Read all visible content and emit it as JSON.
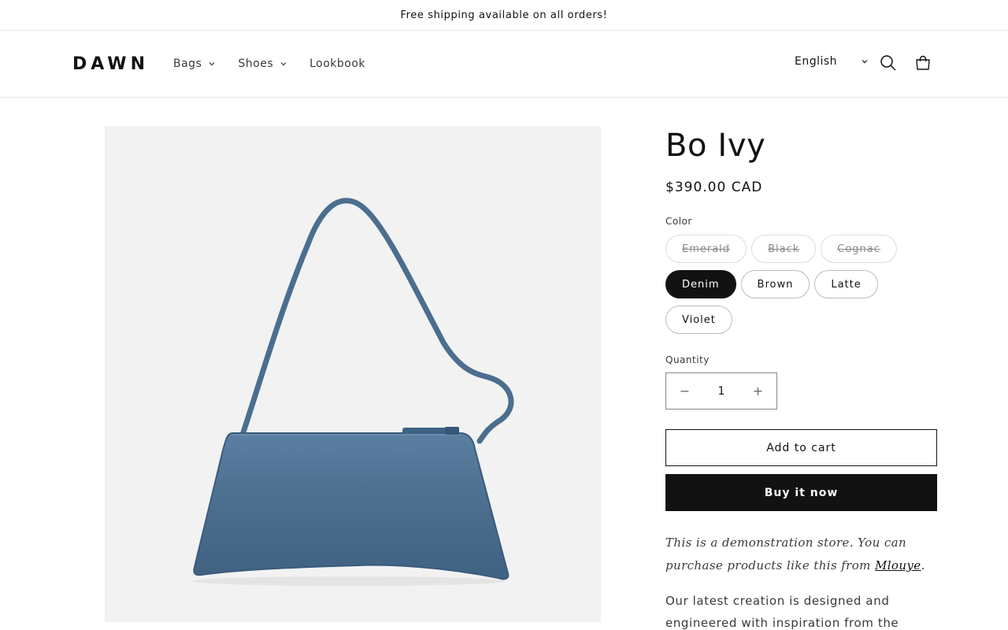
{
  "announcement": {
    "text": "Free shipping available on all orders!"
  },
  "header": {
    "logo": "DAWN",
    "nav": [
      {
        "label": "Bags",
        "has_dropdown": true
      },
      {
        "label": "Shoes",
        "has_dropdown": true
      },
      {
        "label": "Lookbook",
        "has_dropdown": false
      }
    ],
    "language": "English",
    "icons": [
      "chevron-down-icon",
      "search-icon",
      "cart-icon"
    ]
  },
  "product": {
    "title": "Bo Ivy",
    "price": "$390.00 CAD",
    "image_background": "#f2f2f2",
    "bag_color": "#4b6e8f",
    "color_label": "Color",
    "colors": [
      {
        "label": "Emerald",
        "state": "disabled"
      },
      {
        "label": "Black",
        "state": "disabled"
      },
      {
        "label": "Cognac",
        "state": "disabled"
      },
      {
        "label": "Denim",
        "state": "selected"
      },
      {
        "label": "Brown",
        "state": "available"
      },
      {
        "label": "Latte",
        "state": "available"
      },
      {
        "label": "Violet",
        "state": "available"
      }
    ],
    "quantity_label": "Quantity",
    "quantity_value": "1",
    "quantity_minus": "−",
    "quantity_plus": "+",
    "add_to_cart": "Add to cart",
    "buy_now": "Buy it now",
    "demo_note_prefix": "This is a demonstration store. You can purchase products like this from ",
    "demo_note_link": "Mlouye",
    "demo_note_suffix": ".",
    "description": "Our latest creation is designed and engineered with inspiration from the"
  },
  "colors": {
    "text": "#121212",
    "border": "#e6e6e6",
    "button_solid": "#121212"
  }
}
